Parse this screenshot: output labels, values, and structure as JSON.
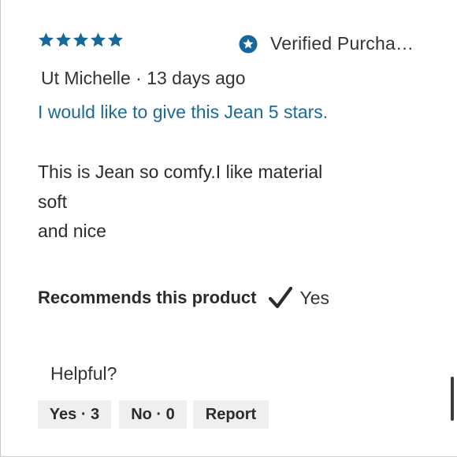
{
  "review": {
    "rating": 5,
    "rating_max": 5,
    "star_color": "#16679a",
    "verified_label": "Verified Purcha…",
    "byline": "Ut Michelle · 13 days ago",
    "headline": "I would like to give this Jean 5 stars.",
    "body_lines": [
      "This is Jean so comfy.I like material",
      "soft",
      "and nice"
    ],
    "recommend_label": "Recommends this product",
    "recommend_value": "Yes",
    "helpful_label": "Helpful?",
    "buttons": {
      "yes": "Yes · 3",
      "no": "No · 0",
      "report": "Report"
    }
  },
  "icons": {
    "star": "star-icon",
    "verified": "verified-badge-icon",
    "recommend": "checkmark-icon"
  }
}
